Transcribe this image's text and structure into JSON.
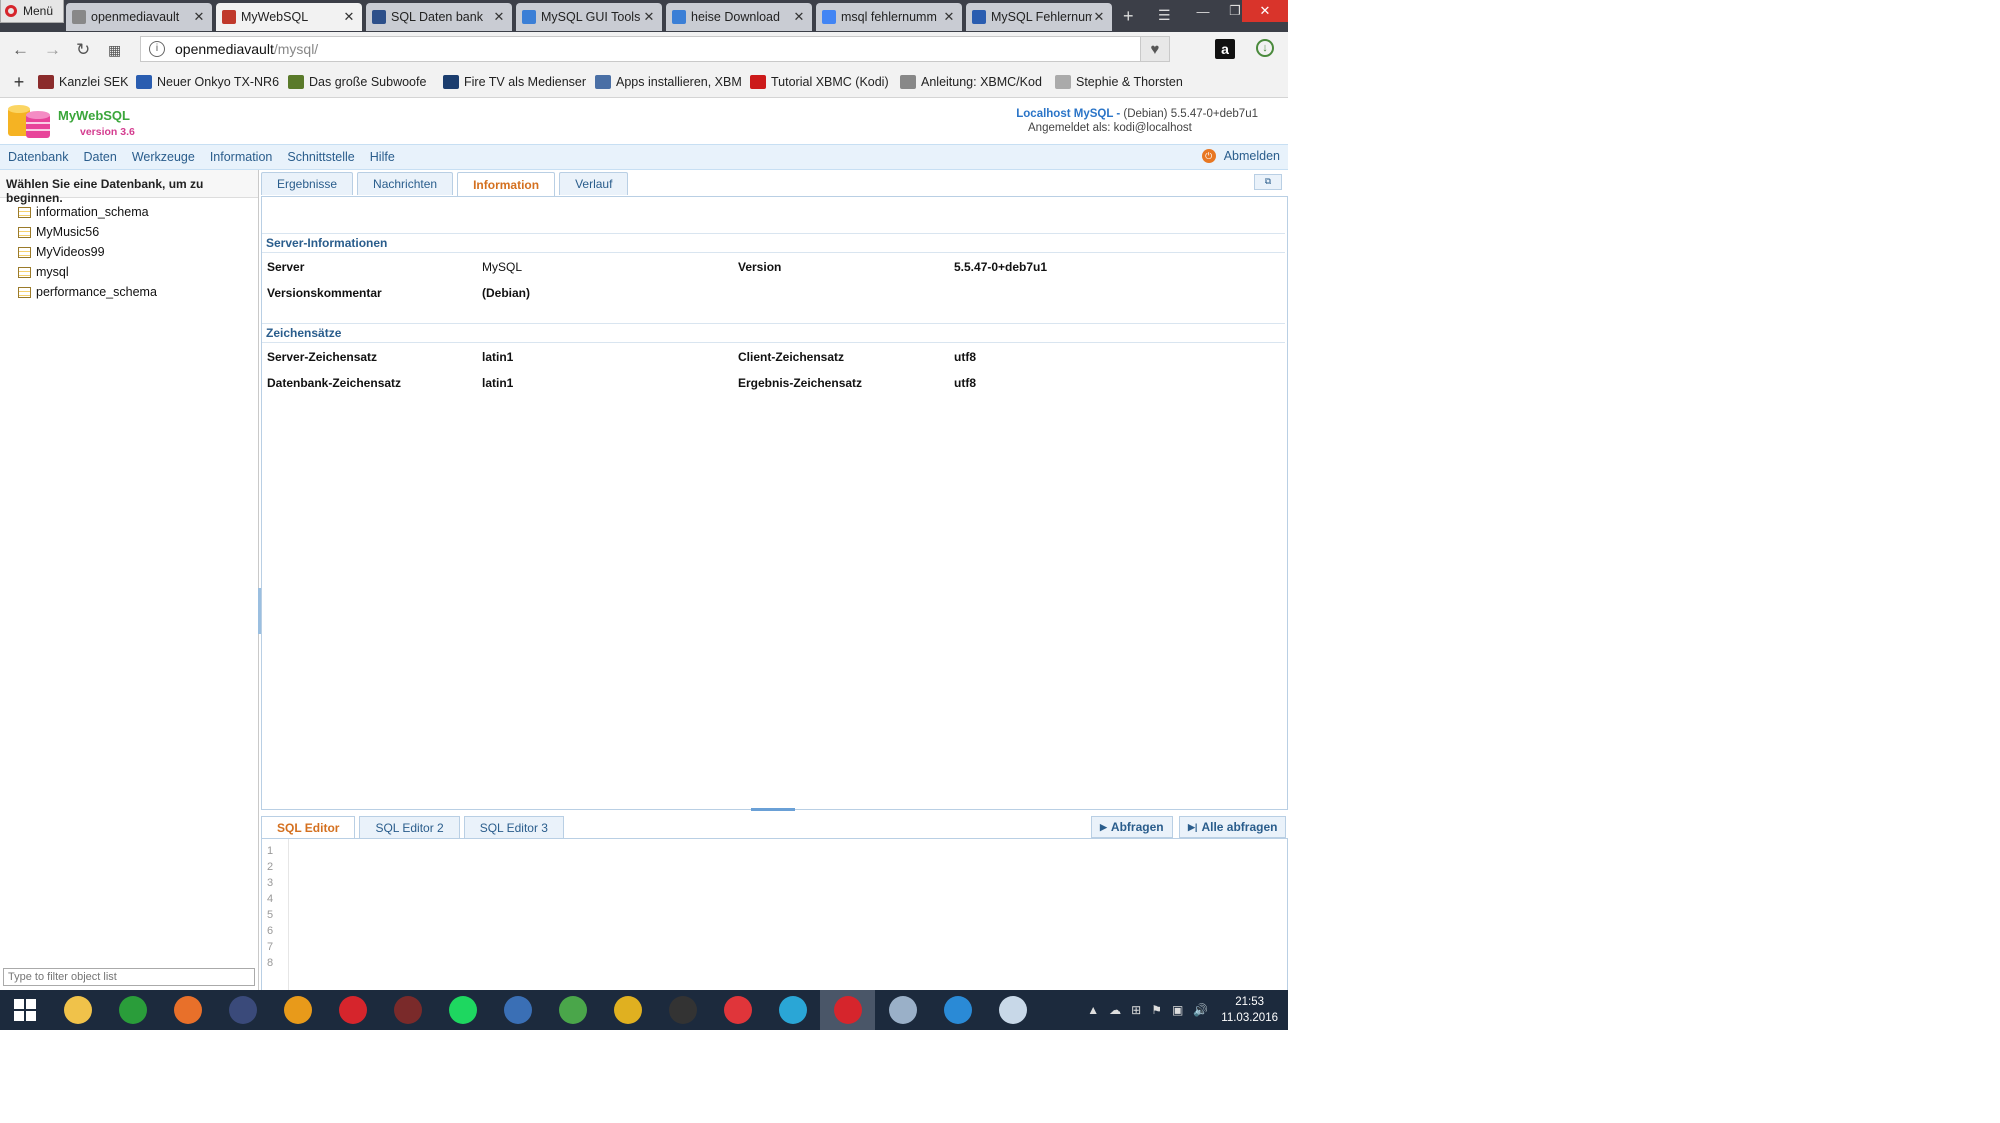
{
  "browser": {
    "menu_label": "Menü",
    "tabs": [
      {
        "label": "openmediavault",
        "color": "#888888"
      },
      {
        "label": "MyWebSQL",
        "color": "#c0392b"
      },
      {
        "label": "SQL Daten bank",
        "color": "#2c4f8a"
      },
      {
        "label": "MySQL GUI Tools",
        "color": "#3b7fd6"
      },
      {
        "label": "heise Download",
        "color": "#3b7fd6"
      },
      {
        "label": "msql fehlernumm",
        "color": "#4285f4"
      },
      {
        "label": "MySQL Fehlernum",
        "color": "#2a5db0"
      }
    ],
    "url_host": "openmediavault",
    "url_path": "/mysql/",
    "bookmarks": [
      {
        "label": "Kanzlei SEK",
        "color": "#8b2c2c"
      },
      {
        "label": "Neuer Onkyo TX-NR6",
        "color": "#2a5db0"
      },
      {
        "label": "Das große Subwoofe",
        "color": "#5a7a2a"
      },
      {
        "label": "Fire TV als Medienser",
        "color": "#1b3d6e"
      },
      {
        "label": "Apps installieren, XBM",
        "color": "#4a6fa5"
      },
      {
        "label": "Tutorial XBMC (Kodi)",
        "color": "#cc1a1a"
      },
      {
        "label": "Anleitung: XBMC/Kod",
        "color": "#888888"
      },
      {
        "label": "Stephie & Thorsten",
        "color": "#aaaaaa"
      }
    ]
  },
  "app": {
    "title": "MyWebSQL",
    "version": "version 3.6",
    "server_highlight": "Localhost MySQL -",
    "server_version": "(Debian) 5.5.47-0+deb7u1",
    "logged_in": "Angemeldet als: kodi@localhost",
    "menu": [
      "Datenbank",
      "Daten",
      "Werkzeuge",
      "Information",
      "Schnittstelle",
      "Hilfe"
    ],
    "logout": "Abmelden"
  },
  "sidebar": {
    "title": "Wählen Sie eine Datenbank, um zu beginnen.",
    "databases": [
      "information_schema",
      "MyMusic56",
      "MyVideos99",
      "mysql",
      "performance_schema"
    ],
    "filter_placeholder": "Type to filter object list"
  },
  "main": {
    "tabs": [
      "Ergebnisse",
      "Nachrichten",
      "Information",
      "Verlauf"
    ],
    "active_tab": "Information",
    "server_section": "Server-Informationen",
    "server_rows": [
      {
        "k1": "Server",
        "v1": "MySQL",
        "k2": "Version",
        "v2": "5.5.47-0+deb7u1"
      },
      {
        "k1": "Versionskommentar",
        "v1": "(Debian)",
        "k2": "",
        "v2": ""
      }
    ],
    "charset_section": "Zeichensätze",
    "charset_rows": [
      {
        "k1": "Server-Zeichensatz",
        "v1": "latin1",
        "k2": "Client-Zeichensatz",
        "v2": "utf8"
      },
      {
        "k1": "Datenbank-Zeichensatz",
        "v1": "latin1",
        "k2": "Ergebnis-Zeichensatz",
        "v2": "utf8"
      }
    ]
  },
  "editor": {
    "tabs": [
      "SQL Editor",
      "SQL Editor 2",
      "SQL Editor 3"
    ],
    "query_button": "Abfragen",
    "query_all_button": "Alle abfragen",
    "line_numbers": [
      "1",
      "2",
      "3",
      "4",
      "5",
      "6",
      "7",
      "8"
    ]
  },
  "taskbar": {
    "time": "21:53",
    "date": "11.03.2016",
    "apps": [
      {
        "name": "file-explorer",
        "color": "#f0c24a"
      },
      {
        "name": "store",
        "color": "#2a9d3a"
      },
      {
        "name": "firefox",
        "color": "#e8702a"
      },
      {
        "name": "keepass",
        "color": "#3a4a7a"
      },
      {
        "name": "money",
        "color": "#e89a1a"
      },
      {
        "name": "opera",
        "color": "#d6252c"
      },
      {
        "name": "media",
        "color": "#7a2a2a"
      },
      {
        "name": "spotify",
        "color": "#1ed760"
      },
      {
        "name": "editor",
        "color": "#3a6fb5"
      },
      {
        "name": "globe",
        "color": "#4aa64a"
      },
      {
        "name": "chrome",
        "color": "#e0b020"
      },
      {
        "name": "obs",
        "color": "#333333"
      },
      {
        "name": "vivaldi",
        "color": "#e0353a"
      },
      {
        "name": "kodi",
        "color": "#2aa6d6"
      },
      {
        "name": "opera-active",
        "color": "#d6252c"
      },
      {
        "name": "notes",
        "color": "#9ab0c8"
      },
      {
        "name": "player",
        "color": "#2a8ad6"
      },
      {
        "name": "paint",
        "color": "#c8d8e8"
      }
    ]
  }
}
